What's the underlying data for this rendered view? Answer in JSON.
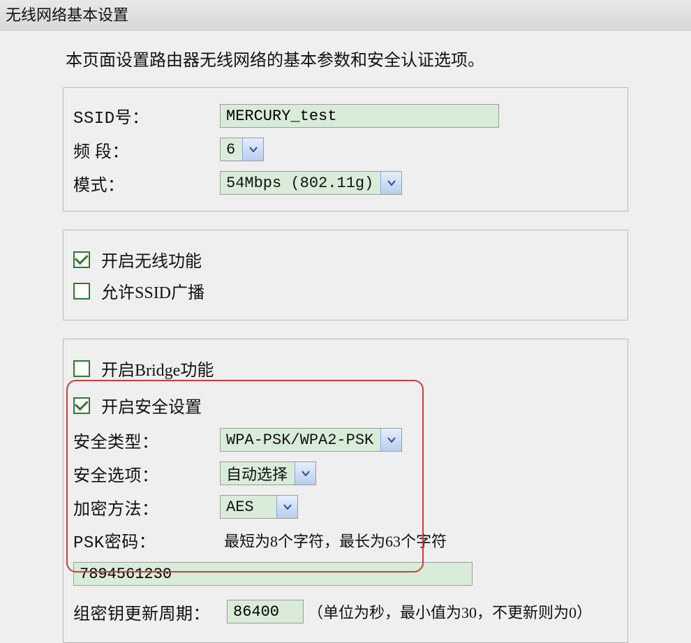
{
  "titlebar": "无线网络基本设置",
  "intro": "本页面设置路由器无线网络的基本参数和安全认证选项。",
  "basic": {
    "ssid_label": "SSID号：",
    "ssid_value": "MERCURY_test",
    "channel_label": "频 段：",
    "channel_value": "6",
    "mode_label": "模式：",
    "mode_value": "54Mbps (802.11g)"
  },
  "wireless": {
    "enable_wireless_label": "开启无线功能",
    "enable_wireless_checked": true,
    "allow_ssid_broadcast_label": "允许SSID广播",
    "allow_ssid_broadcast_checked": false
  },
  "security": {
    "enable_bridge_label": "开启Bridge功能",
    "enable_bridge_checked": false,
    "enable_security_label": "开启安全设置",
    "enable_security_checked": true,
    "sec_type_label": "安全类型：",
    "sec_type_value": "WPA-PSK/WPA2-PSK",
    "sec_option_label": "安全选项：",
    "sec_option_value": "自动选择",
    "enc_method_label": "加密方法：",
    "enc_method_value": "AES",
    "psk_label": "PSK密码：",
    "psk_hint": "最短为8个字符，最长为63个字符",
    "psk_value": "7894561230",
    "group_key_label": "组密钥更新周期：",
    "group_key_value": "86400",
    "group_key_hint": "（单位为秒，最小值为30，不更新则为0）"
  }
}
